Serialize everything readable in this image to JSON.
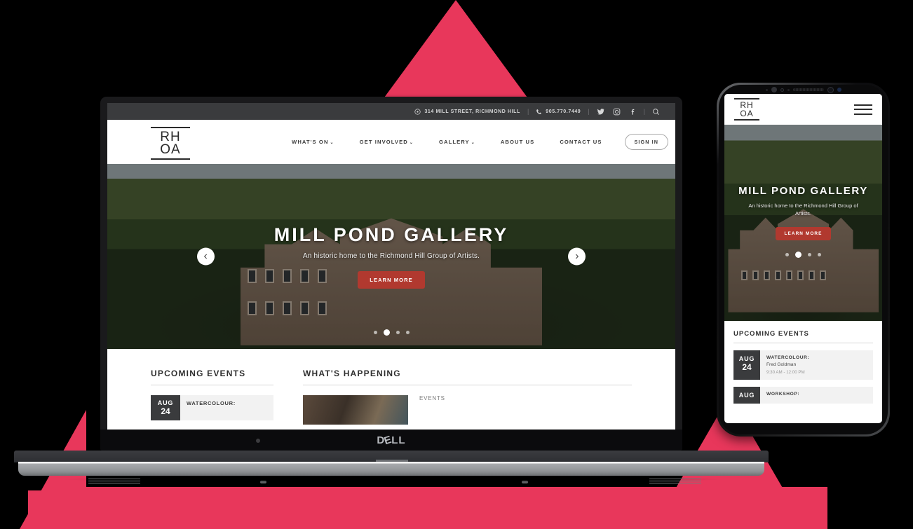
{
  "background": {
    "accent_color": "#E8375B"
  },
  "laptop": {
    "brand": "DELL",
    "site": {
      "topbar": {
        "address_icon": "location-pin-icon",
        "address": "314 MILL STREET, RICHMOND HILL",
        "phone_icon": "phone-icon",
        "phone": "905.770.7449",
        "social": [
          "twitter-icon",
          "instagram-icon",
          "facebook-icon"
        ],
        "search_icon": "search-icon",
        "separator": "|"
      },
      "logo": {
        "line1": "RH",
        "line2": "OA"
      },
      "nav": [
        {
          "label": "WHAT'S ON",
          "caret": "⌄"
        },
        {
          "label": "GET INVOLVED",
          "caret": "⌄"
        },
        {
          "label": "GALLERY",
          "caret": "⌄"
        },
        {
          "label": "ABOUT US",
          "caret": ""
        },
        {
          "label": "CONTACT US",
          "caret": ""
        }
      ],
      "signin_label": "SIGN IN",
      "hero": {
        "title": "MILL POND GALLERY",
        "subtitle": "An historic home to the Richmond Hill Group of Artists.",
        "cta_label": "LEARN MORE",
        "cta_color": "#B1392F",
        "prev_icon": "chevron-left-icon",
        "next_icon": "chevron-right-icon",
        "slide_count": 4,
        "active_slide": 2
      },
      "sections": {
        "events_heading": "UPCOMING EVENTS",
        "happening_heading": "WHAT'S HAPPENING",
        "event": {
          "month": "AUG",
          "day": "24",
          "title": "WATERCOLOUR:"
        },
        "news": {
          "category": "EVENTS"
        }
      }
    }
  },
  "phone": {
    "site": {
      "logo": {
        "line1": "RH",
        "line2": "OA"
      },
      "menu_icon": "hamburger-menu-icon",
      "hero": {
        "title": "MILL POND GALLERY",
        "subtitle": "An historic home to the Richmond Hill Group of Artists.",
        "cta_label": "LEARN MORE",
        "slide_count": 4,
        "active_slide": 2
      },
      "events_heading": "UPCOMING EVENTS",
      "events": [
        {
          "month": "AUG",
          "day": "24",
          "title": "WATERCOLOUR:",
          "subtitle": "Fred Goldman",
          "time": "9:30 AM - 12:00 PM"
        },
        {
          "month": "AUG",
          "day": "",
          "title": "WORKSHOP:",
          "subtitle": "",
          "time": ""
        }
      ]
    }
  }
}
